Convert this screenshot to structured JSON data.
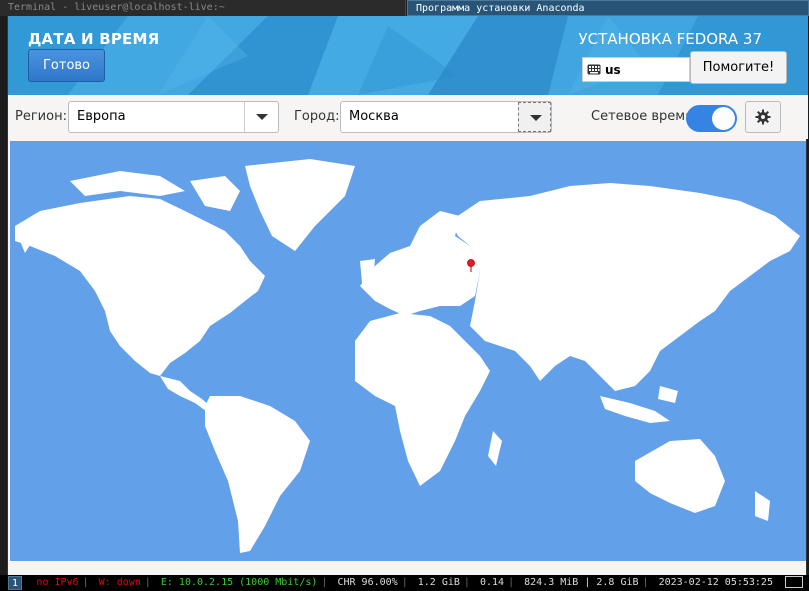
{
  "topbar": {
    "terminal_title": "Terminal - liveuser@localhost-live:~",
    "installer_title": "Программа установки Anaconda"
  },
  "header": {
    "spoke_title": "ДАТА И ВРЕМЯ",
    "done_label": "Готово",
    "product_title": "УСТАНОВКА FEDORA 37",
    "keyboard_layout": "us",
    "help_label": "Помогите!"
  },
  "controls": {
    "region_label": "Регион:",
    "region_value": "Европа",
    "city_label": "Город:",
    "city_value": "Москва",
    "ntp_label": "Сетевое время",
    "ntp_enabled": true
  },
  "map": {
    "selected_city": "Москва",
    "ocean_color": "#62a0ea",
    "land_color": "#ffffff",
    "pin_color": "#e01b24"
  },
  "statusbar": {
    "workspace": "1",
    "ipv6": "no IPv6",
    "wifi": "W: down",
    "ethernet": "E: 10.0.2.15 (1000 Mbit/s)",
    "battery": "CHR 96.00%",
    "disk": "1.2 GiB",
    "load": "0.14",
    "mem": "824.3 MiB | 2.8 GiB",
    "datetime": "2023-02-12 05:53:25"
  },
  "colors": {
    "accent": "#3584e4",
    "header": "#3aa0dd"
  }
}
